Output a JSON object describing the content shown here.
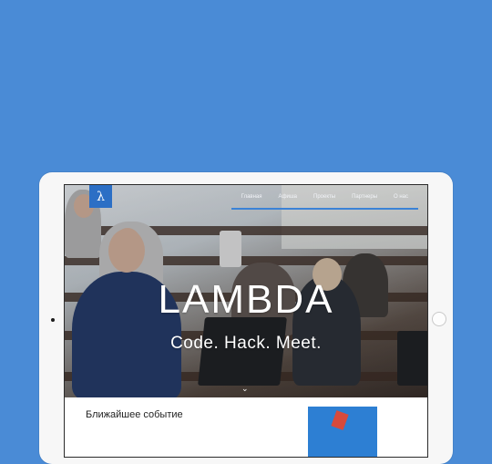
{
  "logo": {
    "symbol": "λ"
  },
  "nav": {
    "items": [
      "Главная",
      "Афиша",
      "Проекты",
      "Партнеры",
      "О нас"
    ]
  },
  "hero": {
    "title": "LAMBDA",
    "tagline": "Code. Hack. Meet.",
    "scroll_icon": "⌄"
  },
  "section": {
    "upcoming_title": "Ближайшее событие"
  },
  "colors": {
    "background": "#4a8bd6",
    "accent": "#2c6fc5"
  },
  "icons": [
    "lambda-logo-icon",
    "chevron-down-icon"
  ]
}
